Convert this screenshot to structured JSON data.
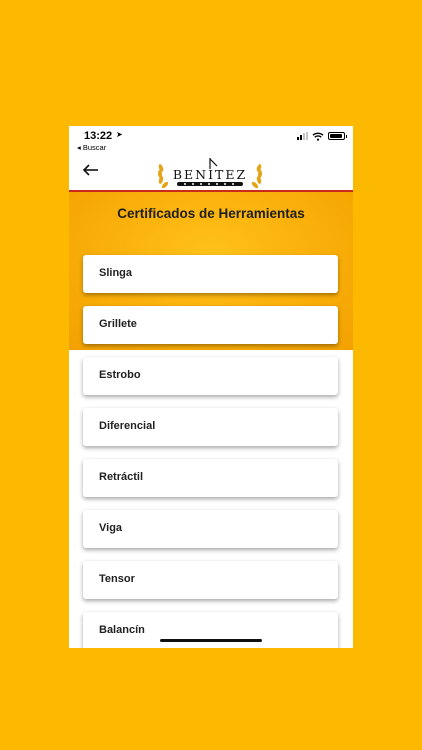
{
  "status_bar": {
    "time": "13:22",
    "back_app": "◂ Buscar"
  },
  "brand": {
    "logo_text": "BENITEZ",
    "accent_color": "#c92a1c",
    "header_color": "#fbb20c"
  },
  "page": {
    "title": "Certificados de Herramientas"
  },
  "items": [
    {
      "label": "Slinga"
    },
    {
      "label": "Grillete"
    },
    {
      "label": "Estrobo"
    },
    {
      "label": "Diferencial"
    },
    {
      "label": "Retráctil"
    },
    {
      "label": "Viga"
    },
    {
      "label": "Tensor"
    },
    {
      "label": "Balancín"
    }
  ]
}
